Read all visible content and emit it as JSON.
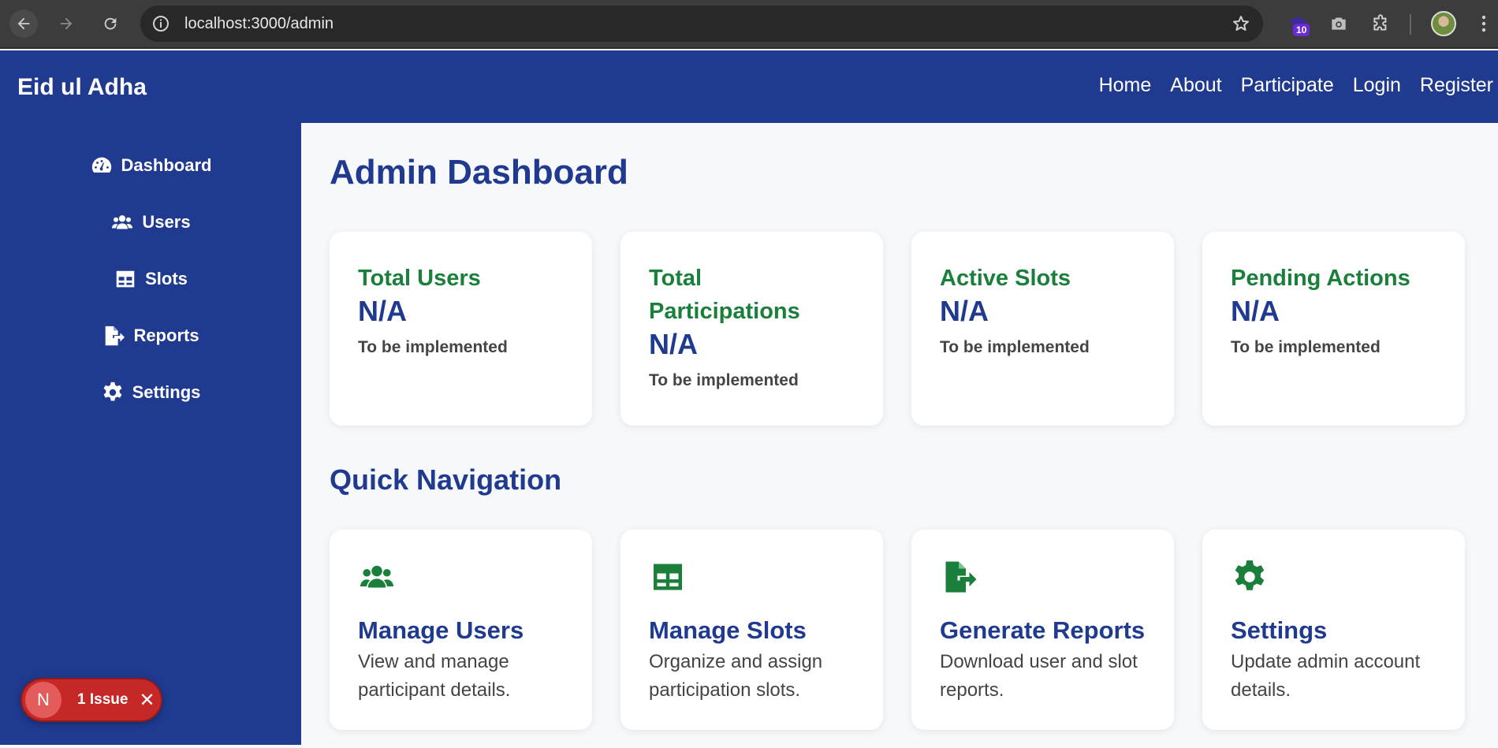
{
  "browser": {
    "url_host": "localhost",
    "url_path": ":3000/admin",
    "extension_badge": "10"
  },
  "header": {
    "brand": "Eid ul Adha",
    "nav": [
      "Home",
      "About",
      "Participate",
      "Login",
      "Register"
    ]
  },
  "sidebar": {
    "items": [
      {
        "label": "Dashboard",
        "icon": "dashboard-gauge-icon"
      },
      {
        "label": "Users",
        "icon": "users-icon"
      },
      {
        "label": "Slots",
        "icon": "table-icon"
      },
      {
        "label": "Reports",
        "icon": "file-export-icon"
      },
      {
        "label": "Settings",
        "icon": "gear-icon"
      }
    ]
  },
  "main": {
    "title": "Admin Dashboard",
    "stats": [
      {
        "title": "Total Users",
        "value": "N/A",
        "note": "To be implemented"
      },
      {
        "title": "Total Participations",
        "value": "N/A",
        "note": "To be implemented"
      },
      {
        "title": "Active Slots",
        "value": "N/A",
        "note": "To be implemented"
      },
      {
        "title": "Pending Actions",
        "value": "N/A",
        "note": "To be implemented"
      }
    ],
    "quick_nav_title": "Quick Navigation",
    "quick_nav": [
      {
        "title": "Manage Users",
        "desc": "View and manage participant details.",
        "icon": "users-icon"
      },
      {
        "title": "Manage Slots",
        "desc": "Organize and assign participation slots.",
        "icon": "table-icon"
      },
      {
        "title": "Generate Reports",
        "desc": "Download user and slot reports.",
        "icon": "file-export-icon"
      },
      {
        "title": "Settings",
        "desc": "Update admin account details.",
        "icon": "gear-icon"
      }
    ]
  },
  "issue_badge": {
    "logo": "N",
    "label": "1 Issue"
  },
  "colors": {
    "primary": "#1f3a8f",
    "accent_green": "#1a7f3a",
    "issue_red": "#c62828"
  }
}
